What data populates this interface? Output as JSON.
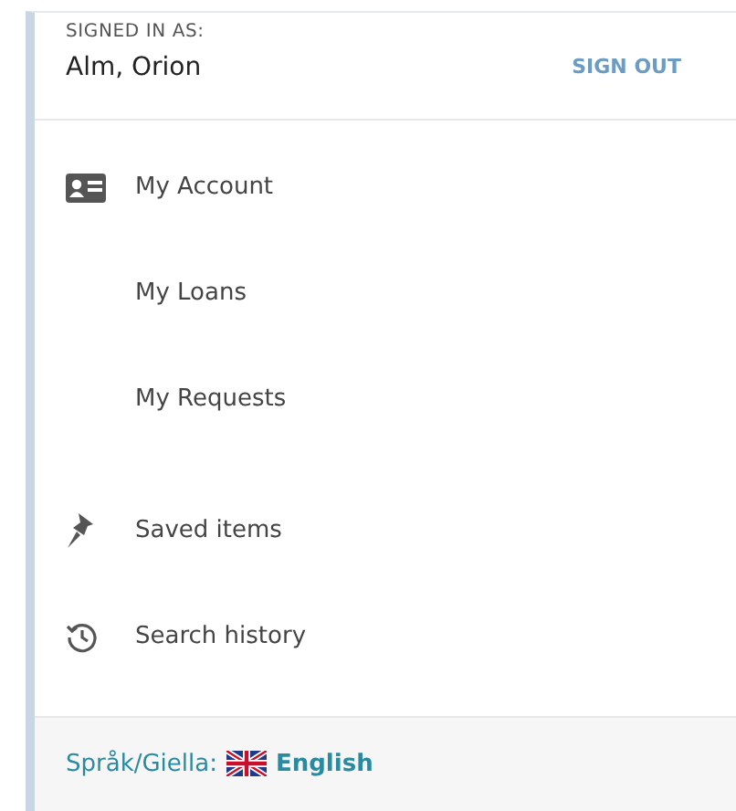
{
  "account": {
    "label": "SIGNED IN AS:",
    "name": "Alm, Orion",
    "sign_out": "SIGN OUT"
  },
  "menu": [
    {
      "label": "My Account",
      "kind": "card"
    },
    {
      "label": "My Loans",
      "kind": "plain"
    },
    {
      "label": "My Requests",
      "kind": "plain"
    },
    {
      "label": "Saved items",
      "kind": "pin"
    },
    {
      "label": "Search history",
      "kind": "history"
    }
  ],
  "footer": {
    "label": "Språk/Giella:",
    "language": "English"
  }
}
